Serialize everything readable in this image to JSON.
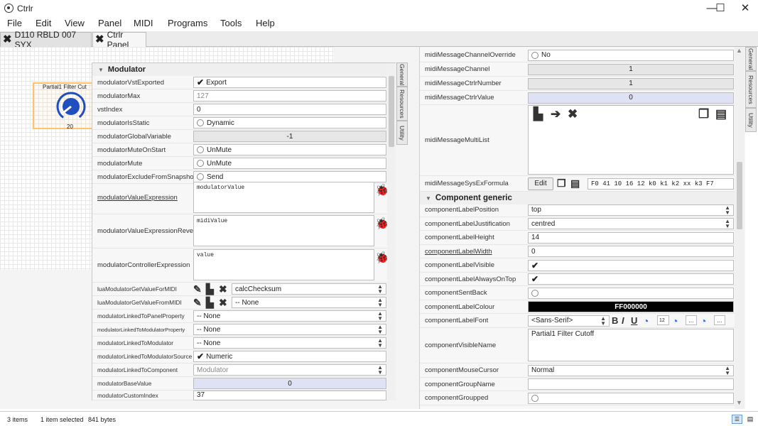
{
  "window": {
    "title": "Ctrlr",
    "minimize": "—",
    "maximize": "☐",
    "close": "✕"
  },
  "menu": [
    "File",
    "Edit",
    "View",
    "Panel",
    "MIDI",
    "Programs",
    "Tools",
    "Help"
  ],
  "tabs": [
    {
      "label": "D110 RBLD 007 SYX"
    },
    {
      "label": "Ctrlr Panel"
    }
  ],
  "canvas": {
    "widget_label": "Partial1 Filter Cut",
    "widget_value": "20"
  },
  "left_panel": {
    "section": "Modulator",
    "vtabs": [
      "General",
      "Resources",
      "Utility"
    ],
    "rows": {
      "vst_exported": {
        "label": "modulatorVstExported",
        "value": "Export"
      },
      "max": {
        "label": "modulatorMax",
        "value": "127"
      },
      "vst_index": {
        "label": "vstIndex",
        "value": "0"
      },
      "is_static": {
        "label": "modulatorIsStatic",
        "value": "Dynamic"
      },
      "global_var": {
        "label": "modulatorGlobalVariable",
        "value": "-1"
      },
      "mute_on_start": {
        "label": "modulatorMuteOnStart",
        "value": "UnMute"
      },
      "mute": {
        "label": "modulatorMute",
        "value": "UnMute"
      },
      "exclude_snapshot": {
        "label": "modulatorExcludeFromSnapshot",
        "value": "Send"
      },
      "value_expr": {
        "label": "modulatorValueExpression",
        "value": "modulatorValue"
      },
      "value_expr_rev": {
        "label": "modulatorValueExpressionReverse",
        "value": "midiValue"
      },
      "ctrl_expr": {
        "label": "modulatorControllerExpression",
        "value": "value"
      },
      "lua_get_for": {
        "label": "luaModulatorGetValueForMIDI",
        "value": "calcChecksum"
      },
      "lua_get_from": {
        "label": "luaModulatorGetValueFromMIDI",
        "value": "-- None"
      },
      "linked_panel": {
        "label": "modulatorLinkedToPanelProperty",
        "value": "-- None"
      },
      "linked_mod_prop": {
        "label": "modulatorLinkedToModulatorProperty",
        "value": "-- None"
      },
      "linked_mod": {
        "label": "modulatorLinkedToModulator",
        "value": "-- None"
      },
      "linked_mod_src": {
        "label": "modulatorLinkedToModulatorSource",
        "value": "Numeric"
      },
      "linked_comp": {
        "label": "modulatorLinkedToComponent",
        "value": "Modulator"
      },
      "base_value": {
        "label": "modulatorBaseValue",
        "value": "0"
      },
      "custom_index": {
        "label": "modulatorCustomIndex",
        "value": "37"
      }
    }
  },
  "right_panel": {
    "vtabs": [
      "General",
      "Resources",
      "Utility"
    ],
    "section": "Component generic",
    "edit_button": "Edit",
    "rows": {
      "chan_override": {
        "label": "midiMessageChannelOverride",
        "value": "No"
      },
      "channel": {
        "label": "midiMessageChannel",
        "value": "1"
      },
      "ctrlr_number": {
        "label": "midiMessageCtrlrNumber",
        "value": "1"
      },
      "ctrlr_value": {
        "label": "midiMessageCtrlrValue",
        "value": "0"
      },
      "multi_list": {
        "label": "midiMessageMultiList"
      },
      "sysex": {
        "label": "midiMessageSysExFormula",
        "value": "F0 41 10 16 12 k0 k1 k2 xx k3 F7"
      },
      "label_pos": {
        "label": "componentLabelPosition",
        "value": "top"
      },
      "label_just": {
        "label": "componentLabelJustification",
        "value": "centred"
      },
      "label_height": {
        "label": "componentLabelHeight",
        "value": "14"
      },
      "label_width": {
        "label": "componentLabelWidth",
        "value": "0"
      },
      "label_visible": {
        "label": "componentLabelVisible"
      },
      "label_ontop": {
        "label": "componentLabelAlwaysOnTop"
      },
      "sent_back": {
        "label": "componentSentBack"
      },
      "label_colour": {
        "label": "componentLabelColour",
        "value": "FF000000"
      },
      "label_font": {
        "label": "componentLabelFont",
        "value": "<Sans-Serif>",
        "size": "12"
      },
      "visible_name": {
        "label": "componentVisibleName",
        "value": "Partial1 Filter Cutoff"
      },
      "mouse_cursor": {
        "label": "componentMouseCursor",
        "value": "Normal"
      },
      "group_name": {
        "label": "componentGroupName",
        "value": ""
      },
      "grouped": {
        "label": "componentGroupped"
      }
    }
  },
  "status": {
    "items": "3 items",
    "selected": "1 item selected",
    "size": "841 bytes"
  },
  "colors": {
    "widget_border": "#ffc46b",
    "knob": "#1f4fbf",
    "blue_field": "#dfe2f4",
    "label_colour": "#000000"
  }
}
